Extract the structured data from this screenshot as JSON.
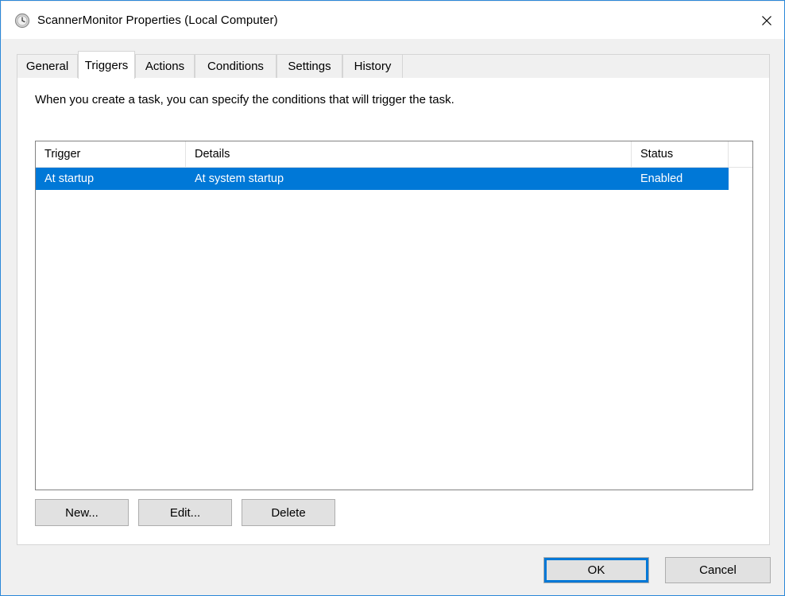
{
  "window": {
    "title": "ScannerMonitor Properties (Local Computer)",
    "title_icon": "clock-schedule-icon",
    "close_label": "×",
    "accent_color": "#0078d7",
    "border_color": "#2b88d8"
  },
  "tabs": [
    {
      "label": "General",
      "selected": false
    },
    {
      "label": "Triggers",
      "selected": true
    },
    {
      "label": "Actions",
      "selected": false
    },
    {
      "label": "Conditions",
      "selected": false
    },
    {
      "label": "Settings",
      "selected": false
    },
    {
      "label": "History",
      "selected": false
    }
  ],
  "triggers_tab": {
    "description": "When you create a task, you can specify the conditions that will trigger the task.",
    "list": {
      "columns": [
        {
          "key": "trigger",
          "label": "Trigger"
        },
        {
          "key": "details",
          "label": "Details"
        },
        {
          "key": "status",
          "label": "Status"
        }
      ],
      "rows": [
        {
          "trigger": "At startup",
          "details": "At system startup",
          "status": "Enabled",
          "selected": true
        }
      ]
    },
    "buttons": {
      "new": "New...",
      "edit": "Edit...",
      "delete": "Delete"
    }
  },
  "footer": {
    "ok": "OK",
    "cancel": "Cancel"
  }
}
